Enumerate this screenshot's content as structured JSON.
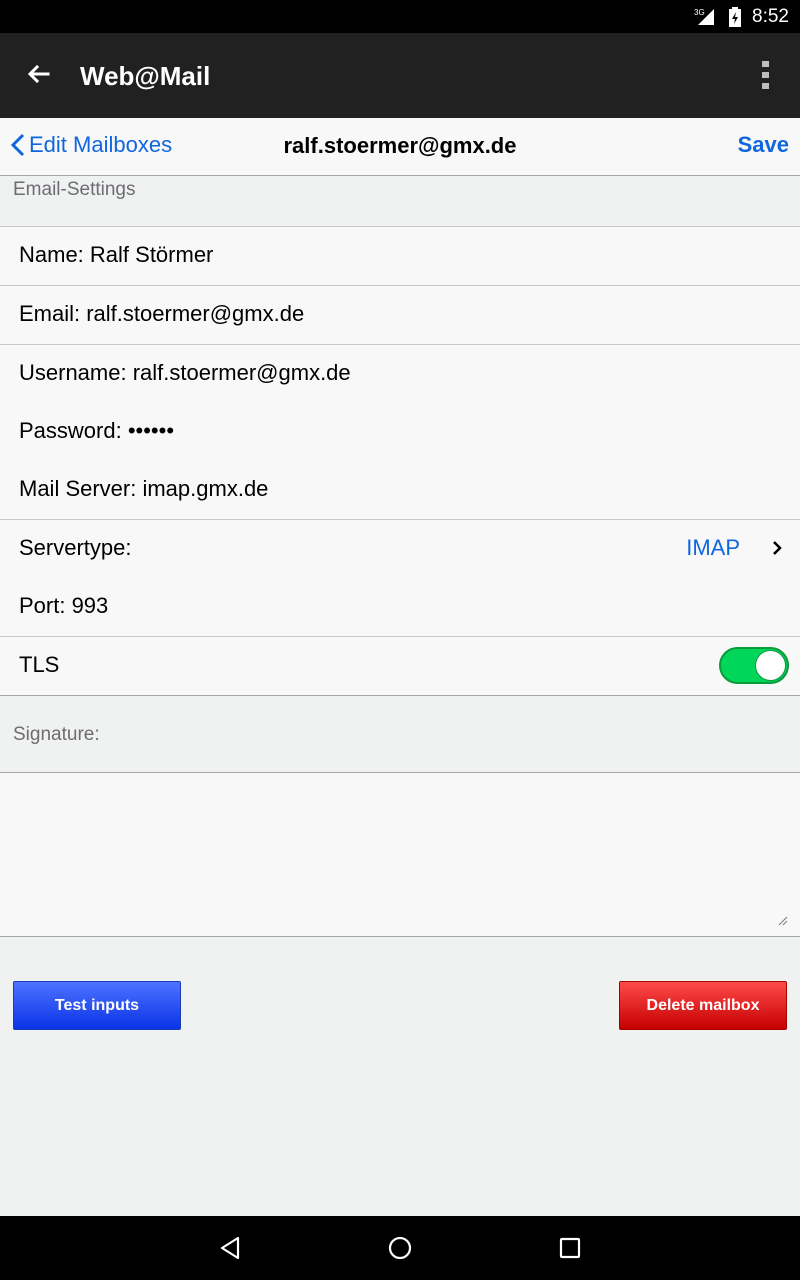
{
  "status_bar": {
    "network": "3G",
    "time": "8:52"
  },
  "app_bar": {
    "title": "Web@Mail",
    "icons": [
      "back-arrow-icon",
      "overflow-menu-icon"
    ]
  },
  "nav_bar": {
    "back_label": "Edit Mailboxes",
    "title": "ralf.stoermer@gmx.de",
    "save_label": "Save"
  },
  "sections": {
    "email_settings": "Email-Settings",
    "signature": "Signature:"
  },
  "fields": {
    "name": "Name: Ralf Störmer",
    "email": "Email: ralf.stoermer@gmx.de",
    "username": "Username: ralf.stoermer@gmx.de",
    "password": "Password: ••••••",
    "mail_server": "Mail Server: imap.gmx.de",
    "servertype_label": "Servertype:",
    "servertype_value": "IMAP",
    "port": "Port: 993",
    "tls_label": "TLS",
    "tls_on": true
  },
  "signature_value": "",
  "buttons": {
    "test": "Test inputs",
    "delete": "Delete mailbox"
  },
  "colors": {
    "accent": "#1066df",
    "toggle_on": "#00d75a",
    "test_button": "#0a33e6",
    "delete_button": "#c50000"
  }
}
